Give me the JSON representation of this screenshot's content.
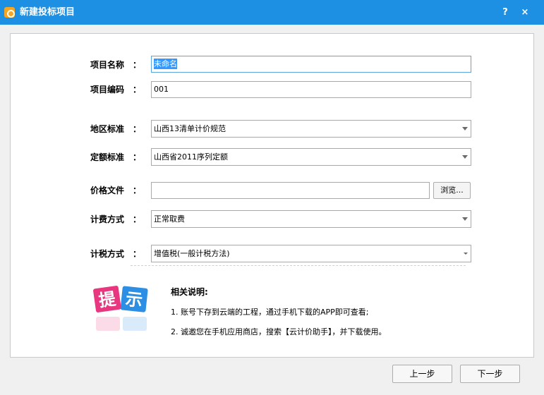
{
  "window": {
    "title": "新建投标项目",
    "help_label": "?",
    "close_label": "×"
  },
  "form": {
    "project_name": {
      "label": "项目名称",
      "colon": "：",
      "value": "未命名"
    },
    "project_code": {
      "label": "项目编码",
      "colon": "：",
      "value": "001"
    },
    "region_standard": {
      "label": "地区标准",
      "colon": "：",
      "value": "山西13清单计价规范"
    },
    "quota_standard": {
      "label": "定额标准",
      "colon": "：",
      "value": "山西省2011序列定额"
    },
    "price_file": {
      "label": "价格文件",
      "colon": "：",
      "value": "",
      "browse_label": "浏览..."
    },
    "fee_method": {
      "label": "计费方式",
      "colon": "：",
      "value": "正常取费"
    },
    "tax_method": {
      "label": "计税方式",
      "colon": "：",
      "value": "增值税(一般计税方法)"
    }
  },
  "hint": {
    "icon": "提示",
    "title": "相关说明:",
    "items": [
      "1. 账号下存到云端的工程，通过手机下载的APP即可查看;",
      "2. 诚邀您在手机应用商店，搜索【云计价助手】，并下载使用。"
    ]
  },
  "footer": {
    "prev_label": "上一步",
    "next_label": "下一步"
  },
  "colors": {
    "titlebar": "#1e90e4",
    "hint_pink": "#e8377f",
    "hint_blue": "#2d8fe3"
  }
}
